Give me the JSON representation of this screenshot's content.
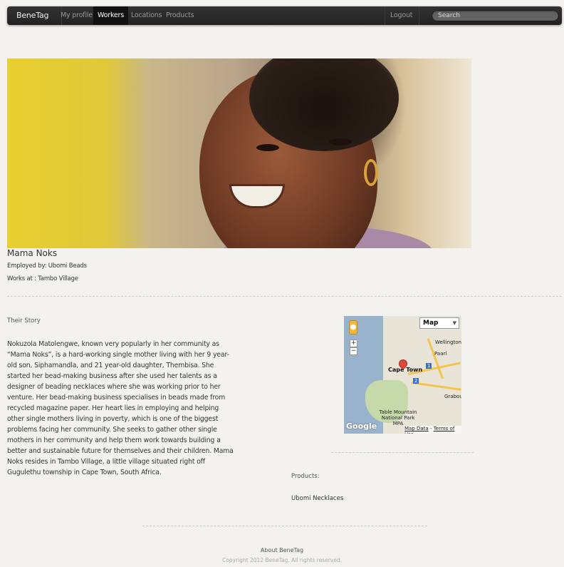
{
  "navbar": {
    "brand": "BeneTag",
    "links": [
      "My profile",
      "Workers",
      "Locations",
      "Products"
    ],
    "active_link": "Workers",
    "logout": "Logout",
    "search_placeholder": "Search"
  },
  "worker": {
    "name": "Mama Noks",
    "employer_line": "Employed by: Ubomi Beads",
    "location_line": "Works at : Tambo Village"
  },
  "story": {
    "heading": "Their Story",
    "text": "Nokuzola Matolengwe, known very popularly in her community as “Mama Noks”, is a hard-working single mother living with her 9 year-old son, Siphamandla, and 21 year-old daughter, Thembisa. She started her bead-making business after she used her talents as a designer of beading necklaces where she was working prior to her venture. Her bead-making business specialises in beads made from recycled magazine paper. Her heart lies in employing and helping other single mothers living in poverty, which is one of the biggest problems facing her community. She seeks to gather other single mothers in her community and help them work towards building a better and sustainable future for themselves and their children. Mama Noks resides in Tambo Village, a little village situated right off Gugulethu township in Cape Town, South Africa."
  },
  "map": {
    "type_label": "Map",
    "zoom_in": "+",
    "zoom_out": "−",
    "labels": {
      "wellington": "Wellington",
      "paarl": "Paarl",
      "cape_town": "Cape Town",
      "grabouw": "Grabou",
      "table_mountain": "Table Mountain National Park MPA",
      "route_1": "1",
      "route_2": "2"
    },
    "google": "Google",
    "map_data": "Map Data",
    "separator": " - ",
    "terms": "Terms of Use"
  },
  "products": {
    "heading": "Products:",
    "items": [
      "Ubomi Necklaces"
    ]
  },
  "footer": {
    "about": "About BeneTag",
    "copyright": "Copyright 2012 BeneTag. All rights reserved."
  }
}
